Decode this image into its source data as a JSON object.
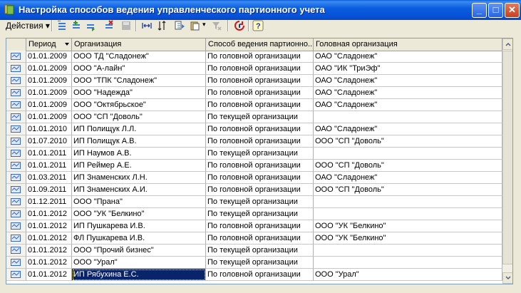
{
  "window": {
    "title": "Настройка способов ведения управленческого партионного учета",
    "minimize_label": "_",
    "maximize_label": "□",
    "close_label": "✕"
  },
  "toolbar": {
    "actions_label": "Действия",
    "icons": [
      "add-icon",
      "add-copy-icon",
      "add-group-icon",
      "delete-icon",
      "save-icon",
      "refresh-range-icon",
      "sort-icon",
      "hierarchy-icon",
      "clipboard-dropdown-icon",
      "filter-off-icon",
      "reread-icon",
      "help-icon"
    ]
  },
  "table": {
    "columns": [
      "Период",
      "Организация",
      "Способ ведения партионно...",
      "Головная организация"
    ],
    "rows": [
      {
        "period": "01.01.2009",
        "org": "ООО ТД \"Сладонеж\"",
        "method": "По головной организации",
        "head": "ОАО \"Сладонеж\""
      },
      {
        "period": "01.01.2009",
        "org": "ООО \"А-лайн\"",
        "method": "По головной организации",
        "head": "ОАО \"ИК \"ТриЭф\""
      },
      {
        "period": "01.01.2009",
        "org": "ООО \"ТПК \"Сладонеж\"",
        "method": "По головной организации",
        "head": "ОАО \"Сладонеж\""
      },
      {
        "period": "01.01.2009",
        "org": "ООО \"Надежда\"",
        "method": "По головной организации",
        "head": "ОАО \"Сладонеж\""
      },
      {
        "period": "01.01.2009",
        "org": "ООО \"Октябрьское\"",
        "method": "По головной организации",
        "head": "ОАО \"Сладонеж\""
      },
      {
        "period": "01.01.2009",
        "org": "ООО \"СП \"Доволь\"",
        "method": "По текущей организации",
        "head": ""
      },
      {
        "period": "01.01.2010",
        "org": "ИП Полищук Л.Л.",
        "method": "По головной организации",
        "head": "ОАО \"Сладонеж\""
      },
      {
        "period": "01.07.2010",
        "org": "ИП Полищук А.В.",
        "method": "По головной организации",
        "head": "ООО \"СП \"Доволь\""
      },
      {
        "period": "01.01.2011",
        "org": "ИП Наумов А.В.",
        "method": "По текущей организации",
        "head": ""
      },
      {
        "period": "01.01.2011",
        "org": "ИП Реймер А.Е.",
        "method": "По головной организации",
        "head": "ООО \"СП \"Доволь\""
      },
      {
        "period": "01.03.2011",
        "org": "ИП Знаменских Л.Н.",
        "method": "По головной организации",
        "head": "ОАО \"Сладонеж\""
      },
      {
        "period": "01.09.2011",
        "org": "ИП Знаменских А.И.",
        "method": "По головной организации",
        "head": "ООО \"СП \"Доволь\""
      },
      {
        "period": "01.12.2011",
        "org": "ООО \"Прана\"",
        "method": "По текущей организации",
        "head": ""
      },
      {
        "period": "01.01.2012",
        "org": "ООО \"УК \"Белкино\"",
        "method": "По текущей организации",
        "head": ""
      },
      {
        "period": "01.01.2012",
        "org": "ИП Пушкарева И.В.",
        "method": "По головной организации",
        "head": "ООО \"УК \"Белкино\""
      },
      {
        "period": "01.01.2012",
        "org": "ФЛ Пушкарева И.В.",
        "method": "По головной организации",
        "head": "ООО \"УК \"Белкино\""
      },
      {
        "period": "01.01.2012",
        "org": "ООО \"Прочий бизнес\"",
        "method": "По текущей организации",
        "head": ""
      },
      {
        "period": "01.01.2012",
        "org": "ООО \"Урал\"",
        "method": "По текущей организации",
        "head": ""
      },
      {
        "period": "01.01.2012",
        "org": "ИП Рябухина Е.С.",
        "method": "По головной организации",
        "head": "ООО \"Урал\"",
        "selected": true
      }
    ]
  }
}
